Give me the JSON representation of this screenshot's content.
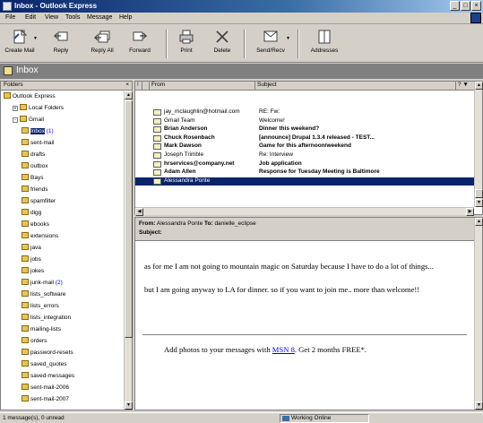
{
  "window": {
    "title": "Inbox - Outlook Express"
  },
  "menu": [
    "File",
    "Edit",
    "View",
    "Tools",
    "Message",
    "Help"
  ],
  "toolbar": [
    {
      "label": "Create Mail",
      "icon": "create-mail-icon",
      "dropdown": true
    },
    {
      "label": "Reply",
      "icon": "reply-icon",
      "dropdown": false
    },
    {
      "label": "Reply All",
      "icon": "reply-all-icon",
      "dropdown": false
    },
    {
      "label": "Forward",
      "icon": "forward-icon",
      "dropdown": false
    },
    {
      "label": "Print",
      "icon": "print-icon",
      "dropdown": false
    },
    {
      "label": "Delete",
      "icon": "delete-icon",
      "dropdown": false
    },
    {
      "label": "Send/Recv",
      "icon": "send-receive-icon",
      "dropdown": true
    },
    {
      "label": "Addresses",
      "icon": "addresses-icon",
      "dropdown": false
    }
  ],
  "folder_bar": {
    "title": "Inbox"
  },
  "folders": {
    "header": "Folders",
    "items": [
      {
        "label": "Outlook Express",
        "depth": 0,
        "expander": "",
        "selected": false
      },
      {
        "label": "Local Folders",
        "depth": 1,
        "expander": "+",
        "selected": false
      },
      {
        "label": "Gmail",
        "depth": 1,
        "expander": "-",
        "selected": false
      },
      {
        "label": "Inbox",
        "count": "(1)",
        "depth": 2,
        "expander": "",
        "selected": true
      },
      {
        "label": "sent-mail",
        "depth": 2,
        "expander": "",
        "selected": false
      },
      {
        "label": "drafts",
        "depth": 2,
        "expander": "",
        "selected": false
      },
      {
        "label": "outbox",
        "depth": 2,
        "expander": "",
        "selected": false
      },
      {
        "label": "Bays",
        "depth": 2,
        "expander": "",
        "selected": false
      },
      {
        "label": "friends",
        "depth": 2,
        "expander": "",
        "selected": false
      },
      {
        "label": "spamfilter",
        "depth": 2,
        "expander": "",
        "selected": false
      },
      {
        "label": "digg",
        "depth": 2,
        "expander": "",
        "selected": false
      },
      {
        "label": "ebooks",
        "depth": 2,
        "expander": "",
        "selected": false
      },
      {
        "label": "extensions",
        "depth": 2,
        "expander": "",
        "selected": false
      },
      {
        "label": "java",
        "depth": 2,
        "expander": "",
        "selected": false
      },
      {
        "label": "jobs",
        "depth": 2,
        "expander": "",
        "selected": false
      },
      {
        "label": "jokes",
        "depth": 2,
        "expander": "",
        "selected": false
      },
      {
        "label": "junk-mail",
        "count": "(2)",
        "depth": 2,
        "expander": "",
        "selected": false
      },
      {
        "label": "lists_software",
        "depth": 2,
        "expander": "",
        "selected": false
      },
      {
        "label": "lists_errors",
        "depth": 2,
        "expander": "",
        "selected": false
      },
      {
        "label": "lists_integration",
        "depth": 2,
        "expander": "",
        "selected": false
      },
      {
        "label": "mailing-lists",
        "depth": 2,
        "expander": "",
        "selected": false
      },
      {
        "label": "orders",
        "depth": 2,
        "expander": "",
        "selected": false
      },
      {
        "label": "password-resets",
        "depth": 2,
        "expander": "",
        "selected": false
      },
      {
        "label": "saved_quotes",
        "depth": 2,
        "expander": "",
        "selected": false
      },
      {
        "label": "saved-messages",
        "depth": 2,
        "expander": "",
        "selected": false
      },
      {
        "label": "sent-mail-2006",
        "depth": 2,
        "expander": "",
        "selected": false
      },
      {
        "label": "sent-mail-2007",
        "depth": 2,
        "expander": "",
        "selected": false
      }
    ]
  },
  "message_list": {
    "columns": [
      "From",
      "Subject"
    ],
    "rows": [
      {
        "from": "jay_mclaughlin@hotmail.com",
        "subject": "RE: Fw:",
        "bold": false,
        "selected": false
      },
      {
        "from": "Gmail Team",
        "subject": "Welcome!",
        "bold": false,
        "selected": false
      },
      {
        "from": "Brian Anderson",
        "subject": "Dinner this weekend?",
        "bold": true,
        "selected": false
      },
      {
        "from": "Chuck Rosenbach",
        "subject": "[announce] Drupal 1.3.4 released - TEST...",
        "bold": true,
        "selected": false
      },
      {
        "from": "Mark Dawson",
        "subject": "Game for this afternoon/weekend",
        "bold": true,
        "selected": false
      },
      {
        "from": "Joseph Trimble",
        "subject": "Re: Interview",
        "bold": false,
        "selected": false
      },
      {
        "from": "hrservices@company.net",
        "subject": "Job application",
        "bold": true,
        "selected": false
      },
      {
        "from": "Adam Allen",
        "subject": "Response for Tuesday Meeting is Baltimore",
        "bold": true,
        "selected": false
      },
      {
        "from": "Alessandra Ponte",
        "subject": "",
        "bold": false,
        "selected": true
      }
    ]
  },
  "preview": {
    "from_label": "From:",
    "from_value": "Alessandra Ponte",
    "to_label": "To:",
    "to_value": "danielle_eclipse",
    "subject_label": "Subject:",
    "subject_value": "",
    "body": [
      "as for me I am not going to mountain magic on Saturday because I have to do a lot of things...",
      "but I am going anyway to LA for dinner. so if you want to join me.. more than welcome!!"
    ],
    "ad_prefix": "Add photos to your messages with",
    "ad_link": "MSN 8",
    "ad_suffix": ". Get 2 months FREE*."
  },
  "status": {
    "left": "1 message(s), 0 unread",
    "right": "Working Online"
  }
}
